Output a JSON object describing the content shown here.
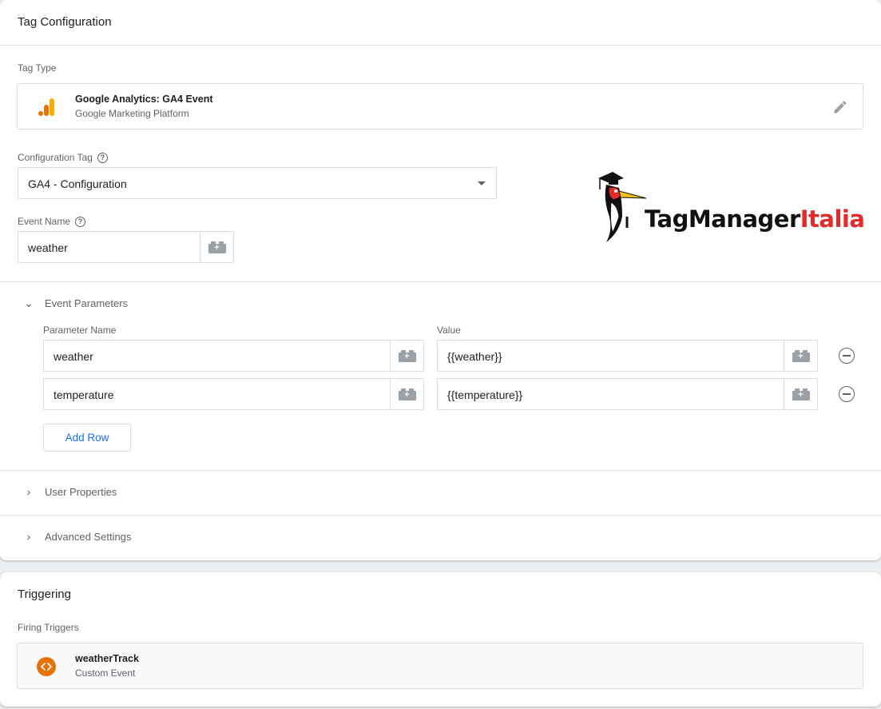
{
  "tag_config": {
    "title": "Tag Configuration",
    "tag_type_label": "Tag Type",
    "tag_type": {
      "name": "Google Analytics: GA4 Event",
      "provider": "Google Marketing Platform"
    },
    "config_tag_label": "Configuration Tag",
    "config_tag_value": "GA4 - Configuration",
    "event_name_label": "Event Name",
    "event_name_value": "weather",
    "event_params": {
      "title": "Event Parameters",
      "col_name": "Parameter Name",
      "col_value": "Value",
      "rows": [
        {
          "name": "weather",
          "value": "{{weather}}"
        },
        {
          "name": "temperature",
          "value": "{{temperature}}"
        }
      ],
      "add_row_label": "Add Row"
    },
    "user_properties_label": "User Properties",
    "advanced_settings_label": "Advanced Settings"
  },
  "logo": {
    "text_dark": "TagManager",
    "text_red": "Italia"
  },
  "triggering": {
    "title": "Triggering",
    "firing_label": "Firing Triggers",
    "trigger": {
      "name": "weatherTrack",
      "type": "Custom Event"
    }
  },
  "colors": {
    "ga_orange": "#f9ab00",
    "ga_dark_orange": "#e37400",
    "trigger_orange": "#e8710a",
    "link_blue": "#1a73e8",
    "logo_red": "#e32b2b"
  },
  "icons": [
    "analytics-bars-icon",
    "pencil-icon",
    "help-icon",
    "dropdown-arrow-icon",
    "variable-icon",
    "chevron-down-icon",
    "chevron-right-icon",
    "remove-circle-icon",
    "custom-event-icon"
  ]
}
